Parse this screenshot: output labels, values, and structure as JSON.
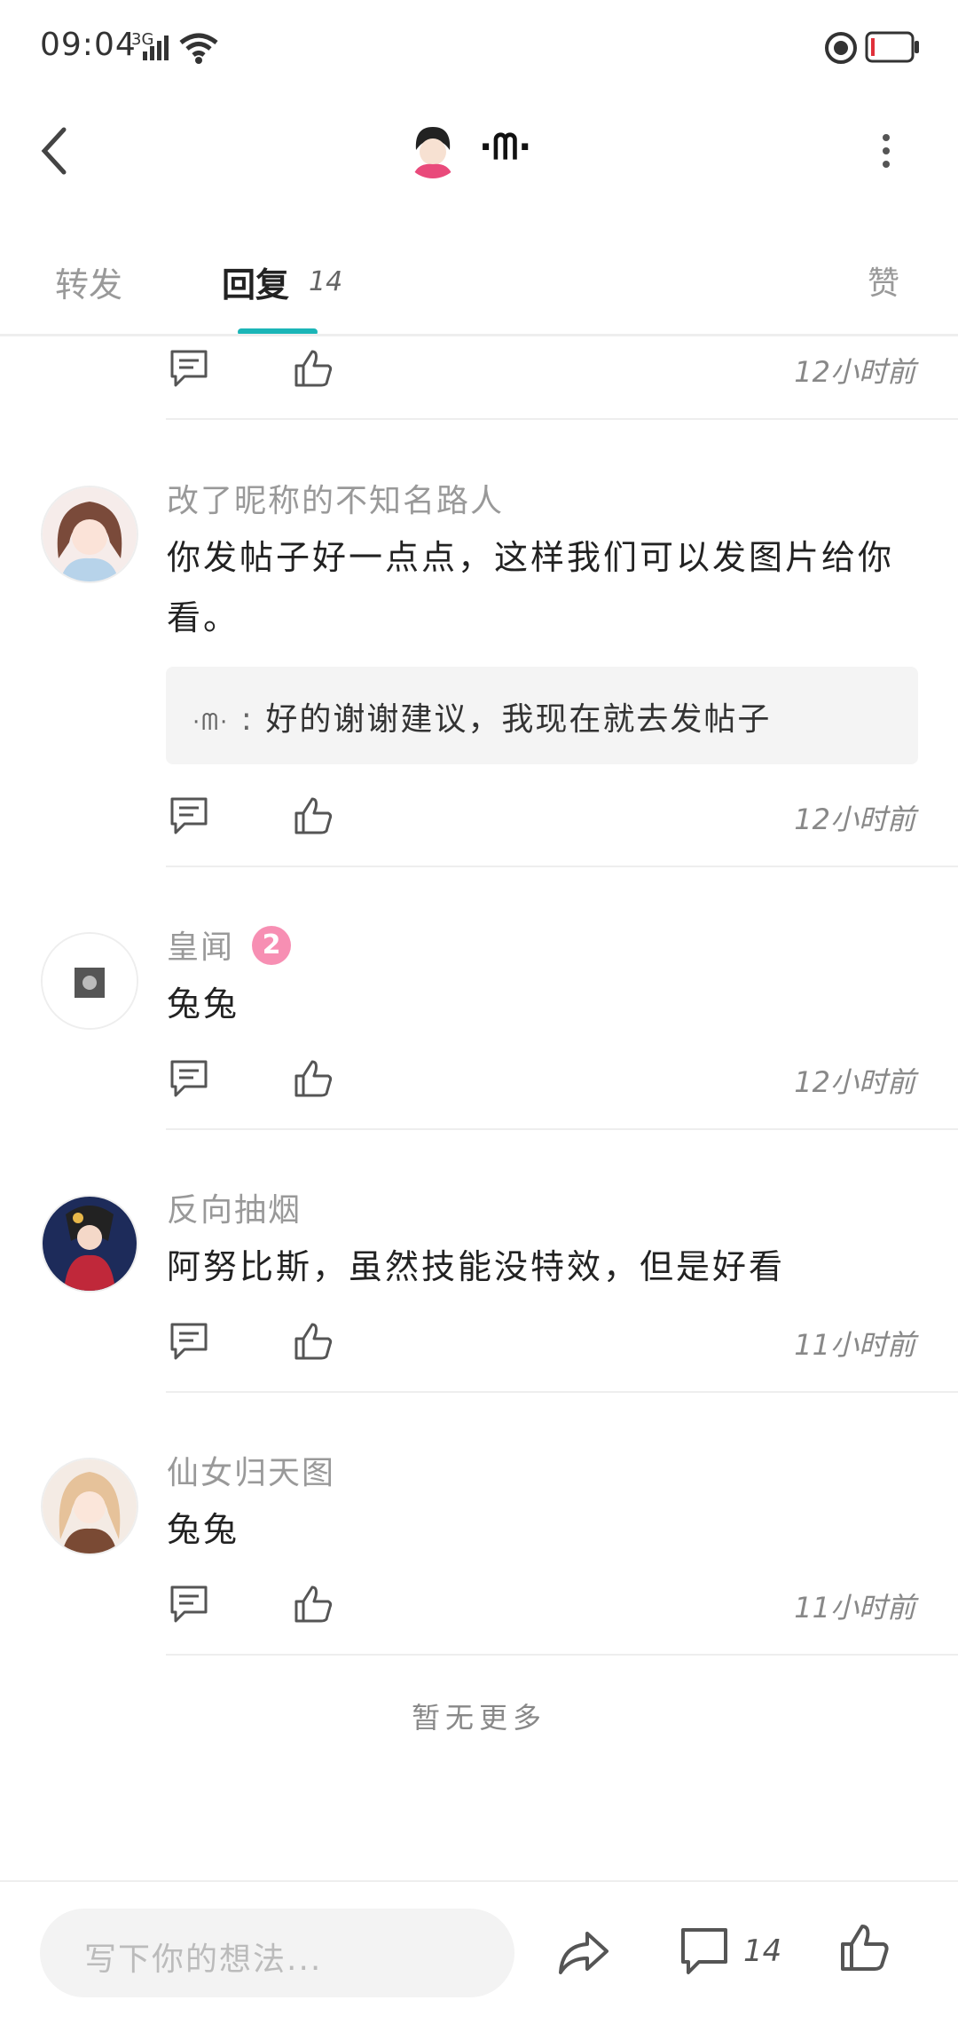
{
  "status_bar": {
    "time": "09:04",
    "network": "3G"
  },
  "header": {
    "title": "·ᗰ·"
  },
  "tabs": {
    "forward": "转发",
    "reply": "回复",
    "reply_count": "14",
    "like": "赞"
  },
  "top_partial": {
    "time": "12小时前"
  },
  "comments": [
    {
      "name": "改了昵称的不知名路人",
      "text": "你发帖子好一点点，这样我们可以发图片给你看。",
      "quote_author": "·ᗰ·",
      "quote_text": "好的谢谢建议，我现在就去发帖子",
      "time": "12小时前"
    },
    {
      "name": "皇闻",
      "badge": "2",
      "text": "兔兔",
      "time": "12小时前"
    },
    {
      "name": "反向抽烟",
      "text": "阿努比斯，虽然技能没特效，但是好看",
      "time": "11小时前"
    },
    {
      "name": "仙女归天图",
      "text": "兔兔",
      "time": "11小时前"
    }
  ],
  "footer_note": "暂无更多",
  "bottom_bar": {
    "input_placeholder": "写下你的想法...",
    "comment_count": "14"
  },
  "colors": {
    "accent": "#1bb5b7",
    "badge": "#f78fb3"
  }
}
